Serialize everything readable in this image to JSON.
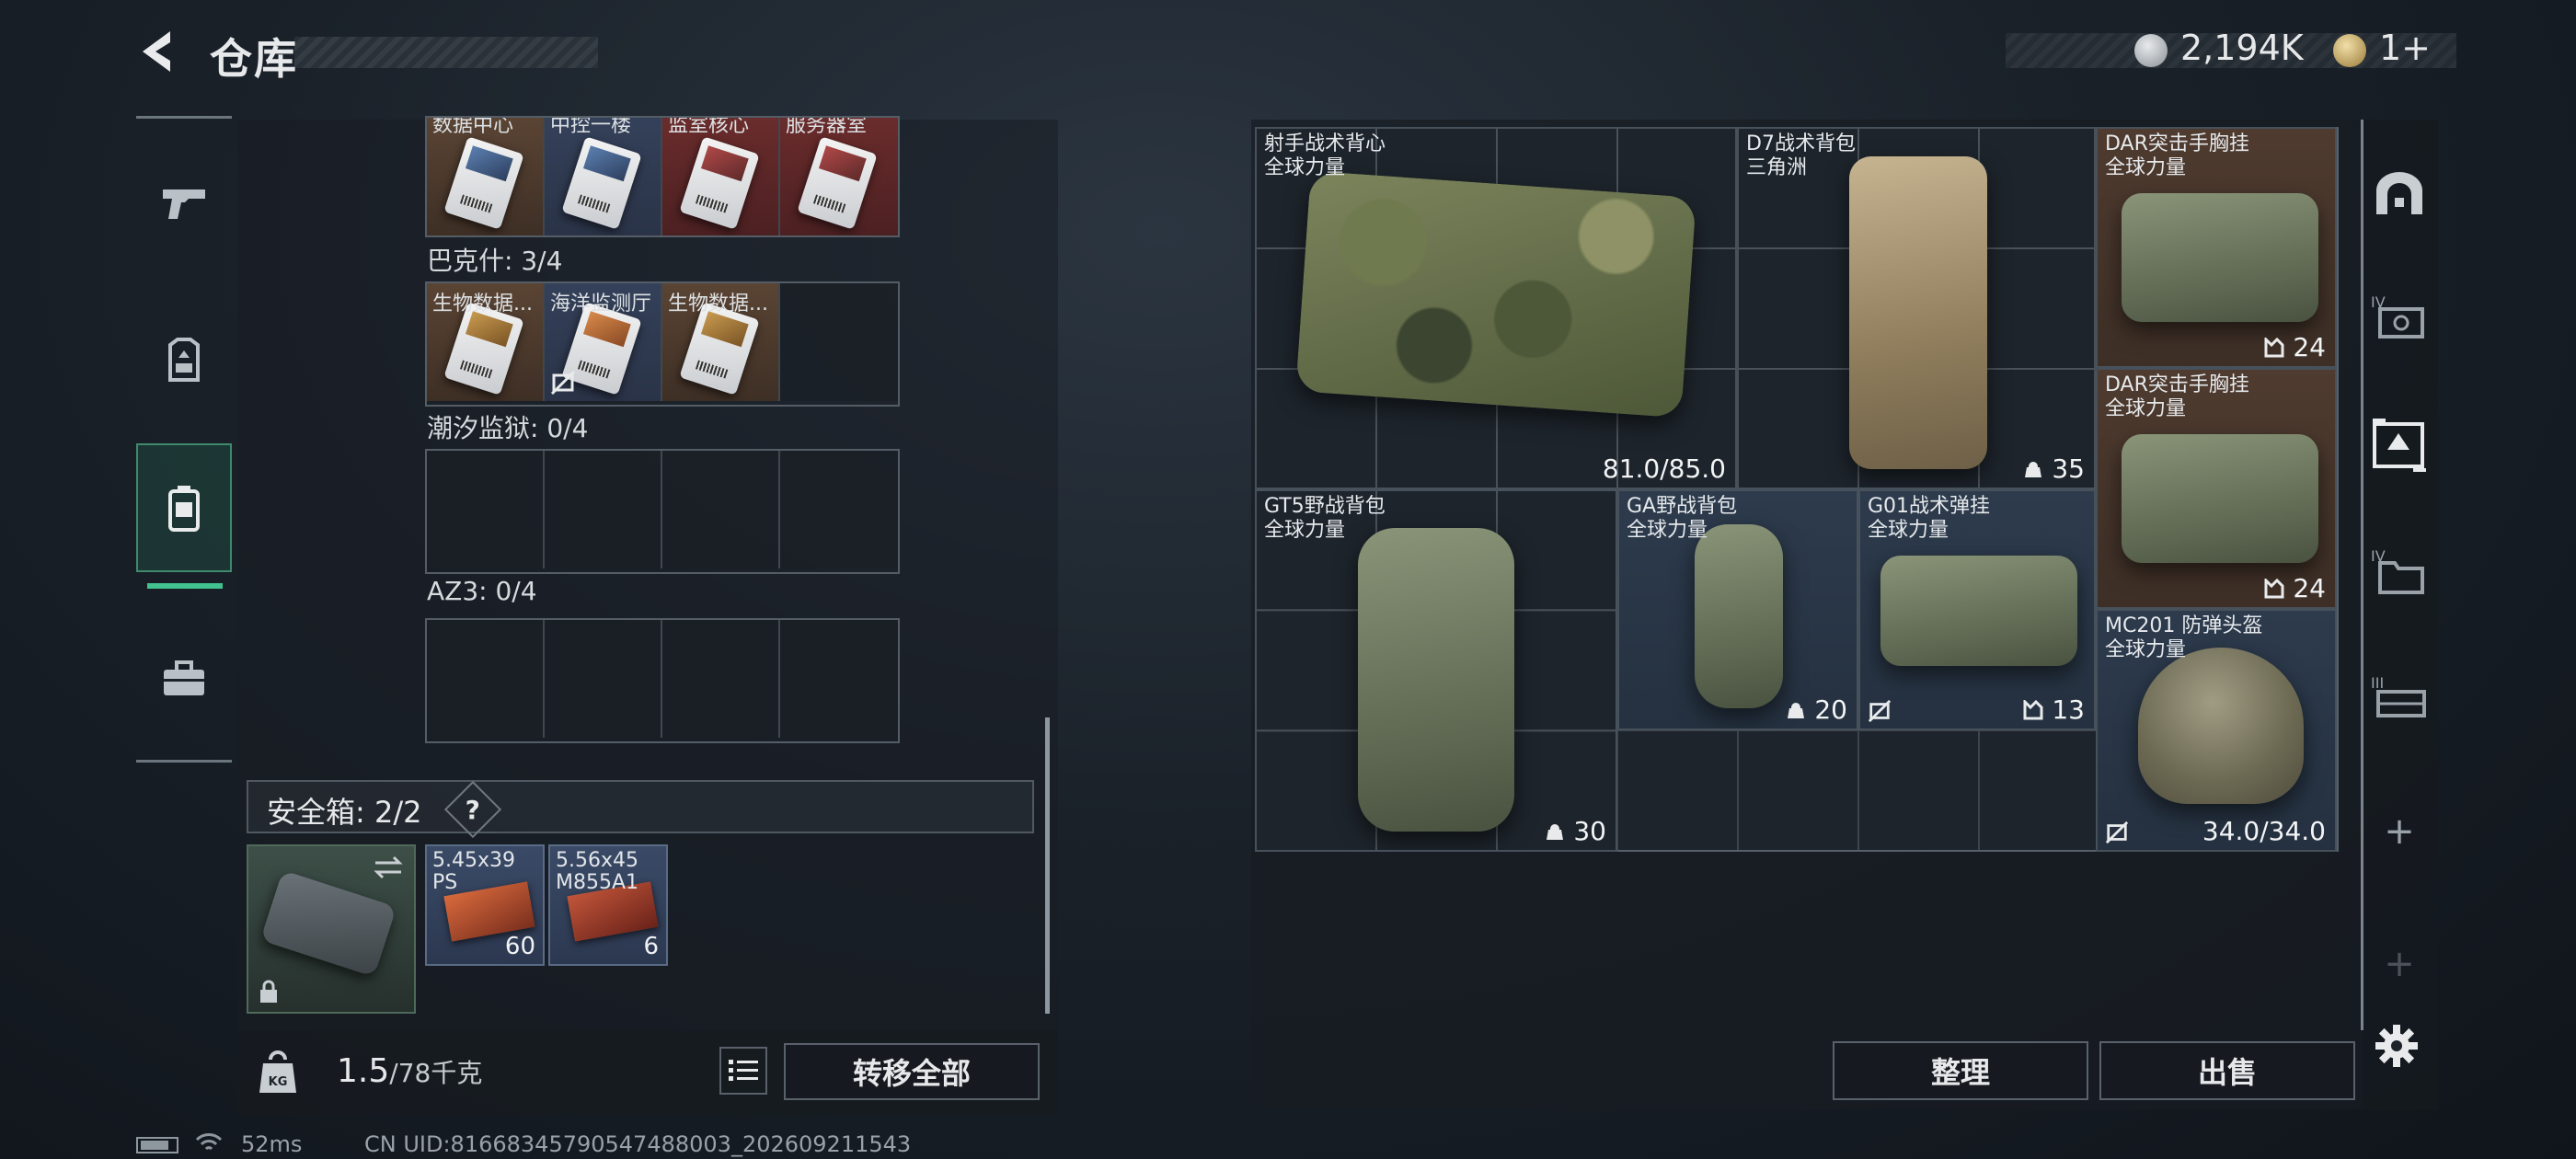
{
  "header": {
    "title": "仓库",
    "money": "2,194K",
    "gold": "1+"
  },
  "left_nav": {
    "items": [
      "weapon-icon",
      "gear-icon",
      "backpack-icon",
      "toolbox-icon"
    ],
    "active": 2
  },
  "card_groups": [
    {
      "label": null,
      "slots": [
        {
          "name": "数据中心",
          "bg": "brown"
        },
        {
          "name": "中控一楼",
          "bg": "blue"
        },
        {
          "name": "监室核心",
          "bg": "red"
        },
        {
          "name": "服务器室",
          "bg": "red"
        }
      ]
    },
    {
      "label": "巴克什: 3/4",
      "slots": [
        {
          "name": "生物数据...",
          "bg": "brown"
        },
        {
          "name": "海洋监测厅",
          "bg": "blue",
          "no_mark": true
        },
        {
          "name": "生物数据...",
          "bg": "brown"
        },
        {
          "name": "",
          "bg": "empty"
        }
      ]
    },
    {
      "label": "潮汐监狱: 0/4",
      "slots": []
    },
    {
      "label": "AZ3: 0/4",
      "slots": []
    }
  ],
  "safe": {
    "label": "安全箱: 2/2",
    "help": "?",
    "ammo": [
      {
        "name": "5.45x39\nPS",
        "count": "60",
        "bg": "blue"
      },
      {
        "name": "5.56x45\nM855A1",
        "count": "6",
        "bg": "blue"
      }
    ]
  },
  "footer_left": {
    "weight": "1.5",
    "weight_max": "/78千克",
    "transfer_all": "转移全部"
  },
  "items": [
    {
      "name": "射手战术背心\n全球力量",
      "value": "81.0/85.0"
    },
    {
      "name": "D7战术背包\n三角洲",
      "value": "35"
    },
    {
      "name": "DAR突击手胸挂\n全球力量",
      "value": "24"
    },
    {
      "name": "DAR突击手胸挂\n全球力量",
      "value": "24"
    },
    {
      "name": "GT5野战背包\n全球力量",
      "value": "30"
    },
    {
      "name": "GA野战背包\n全球力量",
      "value": "20"
    },
    {
      "name": "G01战术弹挂\n全球力量",
      "value": "13"
    },
    {
      "name": "MC201 防弹头盔\n全球力量",
      "value": "34.0/34.0"
    }
  ],
  "footer_right": {
    "sort": "整理",
    "sell": "出售"
  },
  "status": {
    "ping": "52ms",
    "uid": "CN UID:81668345790547488003_202609211543"
  },
  "colors": {
    "accent": "#41c28f",
    "slot_red": "#5a2a30",
    "slot_blue": "#2d3b4d",
    "slot_brown": "#4f3b2f"
  }
}
